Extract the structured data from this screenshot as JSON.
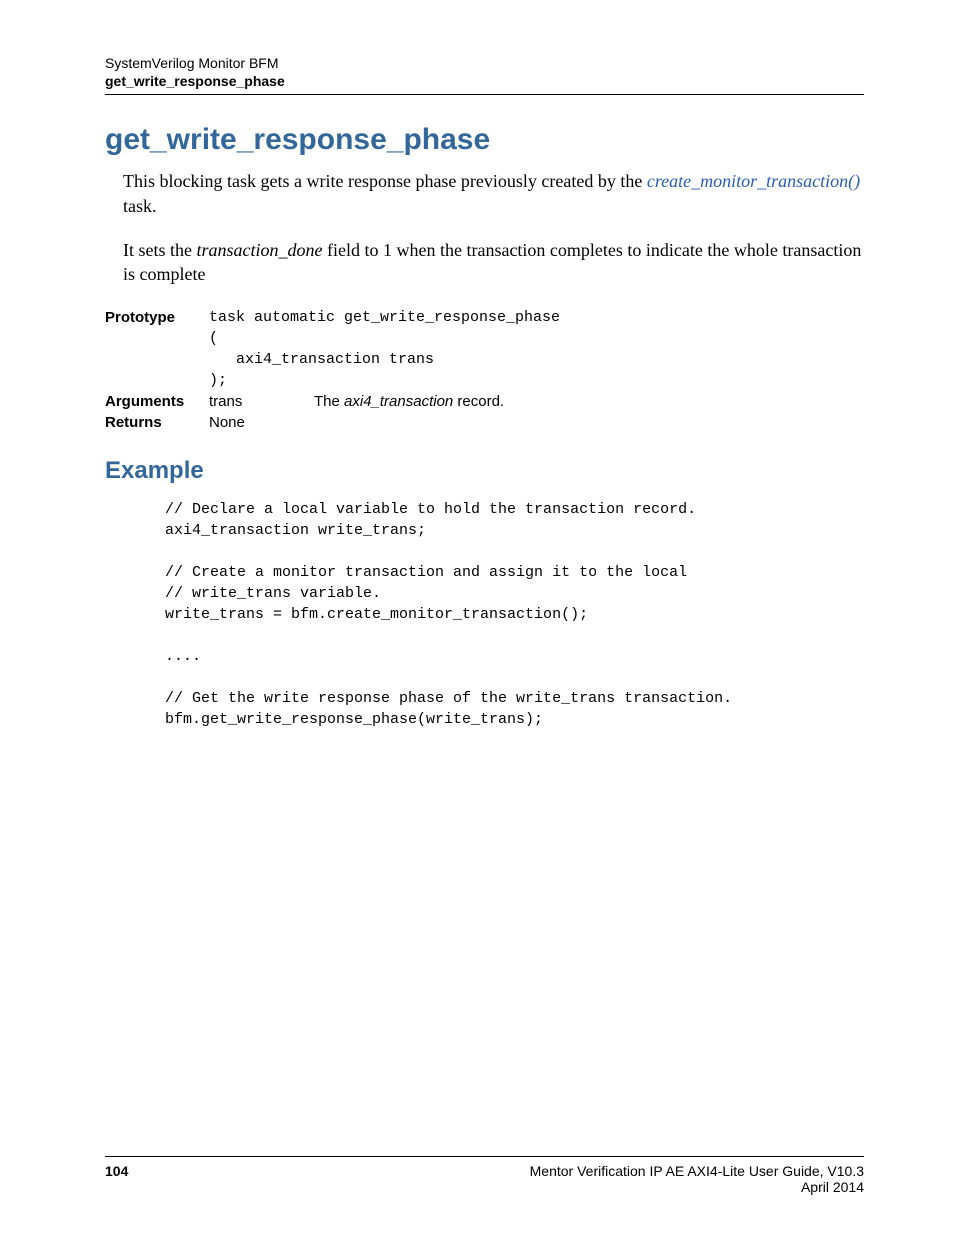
{
  "header": {
    "line1": "SystemVerilog Monitor BFM",
    "line2": "get_write_response_phase"
  },
  "title": "get_write_response_phase",
  "intro": {
    "before_link": "This blocking task gets a write response phase previously created by the ",
    "link_text": "create_monitor_transaction()",
    "after_link": " task."
  },
  "para2": {
    "before_ital": "It sets the ",
    "ital": "transaction_done",
    "after_ital": " field to 1 when the transaction completes to indicate the whole transaction is complete"
  },
  "defs": {
    "prototype_label": "Prototype",
    "prototype_code": "task automatic get_write_response_phase\n(\n   axi4_transaction trans\n);",
    "arguments_label": "Arguments",
    "arguments_name": "trans",
    "arguments_desc_before": "The ",
    "arguments_desc_ital": "axi4_transaction",
    "arguments_desc_after": " record.",
    "returns_label": "Returns",
    "returns_value": "None"
  },
  "example_heading": "Example",
  "example_code": "// Declare a local variable to hold the transaction record.\naxi4_transaction write_trans;\n\n// Create a monitor transaction and assign it to the local\n// write_trans variable.\nwrite_trans = bfm.create_monitor_transaction();\n\n....\n\n// Get the write response phase of the write_trans transaction.\nbfm.get_write_response_phase(write_trans);",
  "footer": {
    "page_number": "104",
    "guide": "Mentor Verification IP AE AXI4-Lite User Guide, V10.3",
    "date": "April 2014"
  }
}
